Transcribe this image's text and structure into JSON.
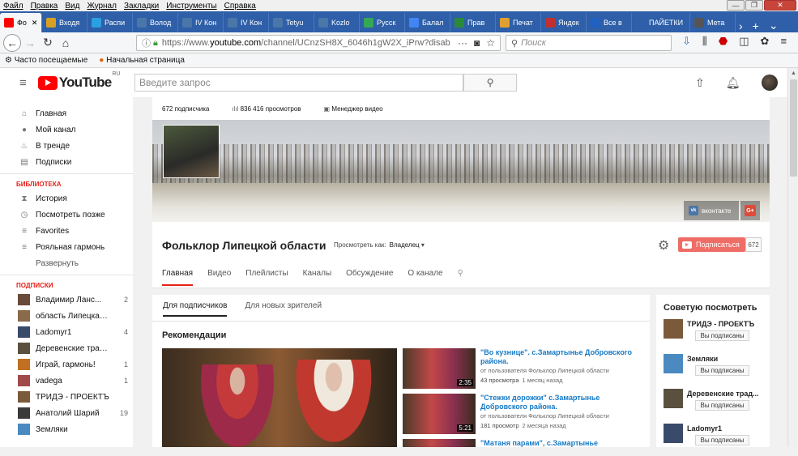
{
  "menubar": [
    "Файл",
    "Правка",
    "Вид",
    "Журнал",
    "Закладки",
    "Инструменты",
    "Справка"
  ],
  "tabs": [
    {
      "label": "Фо",
      "color": "#ff0000",
      "active": true
    },
    {
      "label": "Входя",
      "color": "#d8a020"
    },
    {
      "label": "Распи",
      "color": "#2aa0e0"
    },
    {
      "label": "Волод",
      "color": "#4a76a8"
    },
    {
      "label": "IV Кон",
      "color": "#4a76a8"
    },
    {
      "label": "IV Кон",
      "color": "#4a76a8"
    },
    {
      "label": "Tetyu",
      "color": "#4a76a8"
    },
    {
      "label": "Kozlo",
      "color": "#4a76a8"
    },
    {
      "label": "Русск",
      "color": "#35a855"
    },
    {
      "label": "Балал",
      "color": "#4285f4"
    },
    {
      "label": "Прав",
      "color": "#2a8a3a"
    },
    {
      "label": "Печат",
      "color": "#e0a030"
    },
    {
      "label": "Яндек",
      "color": "#c03030"
    },
    {
      "label": "Все в",
      "color": "#2060c0"
    },
    {
      "label": "ПАЙЕТКИ",
      "color": "#2e5fa8"
    },
    {
      "label": "Мета",
      "color": "#555555"
    }
  ],
  "url": {
    "prefix": "https://www.",
    "domain": "youtube.com",
    "path": "/channel/UCnzSH8X_6046h1gW2X_iPrw?disab"
  },
  "browser_search_placeholder": "Поиск",
  "bookmarks": [
    "Часто посещаемые",
    "Начальная страница"
  ],
  "yt": {
    "logo_text": "YouTube",
    "logo_region": "RU",
    "search_placeholder": "Введите запрос"
  },
  "sidebar": {
    "main": [
      {
        "label": "Главная",
        "icon": "home-icon",
        "glyph": "⌂"
      },
      {
        "label": "Мой канал",
        "icon": "account-icon",
        "glyph": "●"
      },
      {
        "label": "В тренде",
        "icon": "flame-icon",
        "glyph": "♨"
      },
      {
        "label": "Подписки",
        "icon": "subscriptions-icon",
        "glyph": "▤"
      }
    ],
    "library_header": "БИБЛИОТЕКА",
    "library": [
      {
        "label": "История",
        "icon": "history-icon",
        "glyph": "⧗"
      },
      {
        "label": "Посмотреть позже",
        "icon": "watch-later-icon",
        "glyph": "◷"
      },
      {
        "label": "Favorites",
        "icon": "playlist-icon",
        "glyph": "≡"
      },
      {
        "label": "Рояльная гармонь",
        "icon": "playlist-icon",
        "glyph": "≡"
      }
    ],
    "expand": "Развернуть",
    "subs_header": "ПОДПИСКИ",
    "subs": [
      {
        "label": "Владимир Ланс...",
        "count": "2",
        "color": "#6a4a3a"
      },
      {
        "label": "область Липецкая, Н...",
        "count": "",
        "color": "#8a6a4a"
      },
      {
        "label": "Ladomyr1",
        "count": "4",
        "color": "#3a4a6a"
      },
      {
        "label": "Деревенские традиц...",
        "count": "",
        "color": "#5a5040"
      },
      {
        "label": "Играй, гармонь!",
        "count": "1",
        "color": "#c07020"
      },
      {
        "label": "vadega",
        "count": "1",
        "color": "#a04a4a"
      },
      {
        "label": "ТРИДЭ - ПРОЕКТЪ",
        "count": "",
        "color": "#7a5a3a"
      },
      {
        "label": "Анатолий Шарий",
        "count": "19",
        "color": "#3a3a3a"
      },
      {
        "label": "Земляки",
        "count": "",
        "color": "#4a8ac0"
      }
    ]
  },
  "channel": {
    "stats": {
      "subscribers": "672 подписчика",
      "views": "836 416 просмотров",
      "manager": "Менеджер видео"
    },
    "name": "Фольклор Липецкой области",
    "view_as_label": "Просмотреть как:",
    "view_as_value": "Владелец",
    "vk": "вконтакте",
    "gplus": "G+",
    "subscribe": "Подписаться",
    "sub_count": "672",
    "tabs": [
      "Главная",
      "Видео",
      "Плейлисты",
      "Каналы",
      "Обсуждение",
      "О канале"
    ]
  },
  "main": {
    "subtabs": [
      "Для подписчиков",
      "Для новых зрителей"
    ],
    "section_title": "Рекомендации",
    "videos": [
      {
        "title": "\"Во кузнице\". с.Замартынье Добровского района.",
        "by": "от пользователя Фольклор Липецкой области",
        "views": "43 просмотра",
        "ago": "1 месяц назад",
        "duration": "2:35"
      },
      {
        "title": "\"Стежки дорожки\" с.Замартынье Добровского района.",
        "by": "от пользователя Фольклор Липецкой области",
        "views": "181 просмотр",
        "ago": "2 месяца назад",
        "duration": "5:21"
      },
      {
        "title": "\"Матаня парами\", с.Замартынье",
        "by": "",
        "views": "",
        "ago": "",
        "duration": ""
      }
    ]
  },
  "right": {
    "title": "Советую посмотреть",
    "items": [
      {
        "name": "ТРИДЭ - ПРОЕКТЪ",
        "btn": "Вы подписаны",
        "color": "#7a5a3a"
      },
      {
        "name": "Земляки",
        "btn": "Вы подписаны",
        "color": "#4a8ac0"
      },
      {
        "name": "Деревенские трад...",
        "btn": "Вы подписаны",
        "color": "#5a5040"
      },
      {
        "name": "Ladomyr1",
        "btn": "Вы подписаны",
        "color": "#3a4a6a"
      }
    ]
  }
}
